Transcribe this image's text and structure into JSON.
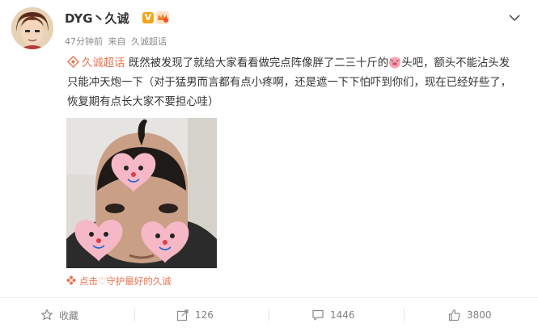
{
  "post": {
    "username": "DYG丶久诚",
    "verified_badge": "V",
    "meta": {
      "time": "47分钟前",
      "source_prefix": "来自",
      "source": "久诚超话"
    },
    "topic": "久诚超话",
    "text_part1": "既然被发现了就给大家看看做完点阵像胖了二三十斤的",
    "text_part2": "头吧，额头不能沾头发只能冲天炮一下（对于猛男而言都有点小疼啊，还是遮一下下怕吓到你们，现在已经好些了，恢复期有点长大家不要担心哇）",
    "photo_caption": "点击♡守护最好的久诚"
  },
  "actions": {
    "favorite_label": "收藏",
    "share_count": "126",
    "comment_count": "1446",
    "like_count": "3800"
  },
  "colors": {
    "topic": "#eb7350",
    "badge": "#f4a41a",
    "muted": "#8b8b8b"
  },
  "icons": [
    "avatar",
    "verified-icon",
    "crown-icon",
    "chevron-down-icon",
    "topic-icon",
    "pig-emoji-icon",
    "flower-icon",
    "star-icon",
    "share-icon",
    "comment-icon",
    "thumbs-up-icon"
  ]
}
